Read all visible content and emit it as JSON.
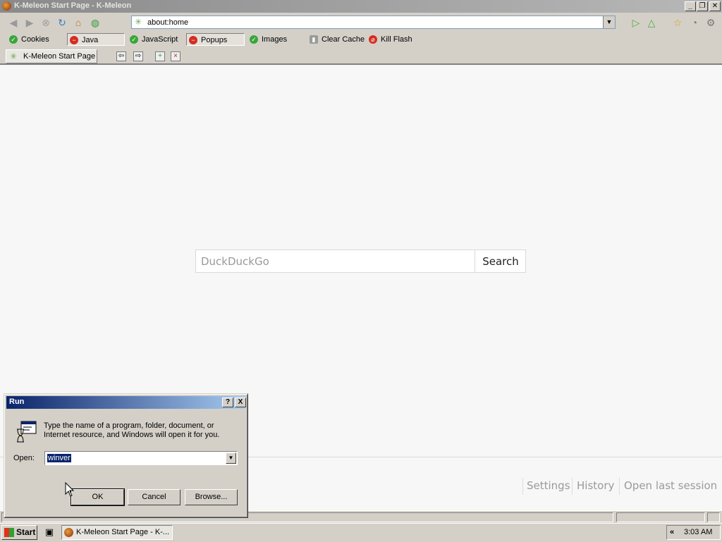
{
  "window": {
    "title": "K-Meleon Start Page - K-Meleon"
  },
  "navbar": {
    "url": "about:home",
    "icons": [
      "back-icon",
      "forward-icon",
      "stop-icon",
      "reload-icon",
      "home-icon",
      "globe-icon",
      "go-icon",
      "up-icon",
      "bookmark-star-icon",
      "history-icon",
      "settings-gear-icon"
    ]
  },
  "prefbar": {
    "items": [
      {
        "label": "Cookies",
        "state": "on"
      },
      {
        "label": "Java",
        "state": "off"
      },
      {
        "label": "JavaScript",
        "state": "on"
      },
      {
        "label": "Popups",
        "state": "off"
      },
      {
        "label": "Images",
        "state": "on"
      },
      {
        "label": "Clear Cache",
        "state": "action"
      },
      {
        "label": "Kill Flash",
        "state": "action"
      }
    ]
  },
  "tabs": [
    {
      "label": "K-Meleon Start Page"
    }
  ],
  "page": {
    "search_placeholder": "DuckDuckGo",
    "search_button": "Search",
    "footer_links": [
      "Settings",
      "History",
      "Open last session"
    ]
  },
  "run_dialog": {
    "title": "Run",
    "message": "Type the name of a program, folder, document, or Internet resource, and Windows will open it for you.",
    "open_label": "Open:",
    "open_value": "winver",
    "buttons": {
      "ok": "OK",
      "cancel": "Cancel",
      "browse": "Browse..."
    },
    "help_glyph": "?",
    "close_glyph": "X"
  },
  "taskbar": {
    "start_label": "Start",
    "task_label": "K-Meleon Start Page - K-...",
    "tray_chevron": "«",
    "clock": "3:03 AM"
  },
  "colors": {
    "title_active": "#0a246a",
    "pref_on": "#3aa53a",
    "pref_off": "#d62c20"
  }
}
